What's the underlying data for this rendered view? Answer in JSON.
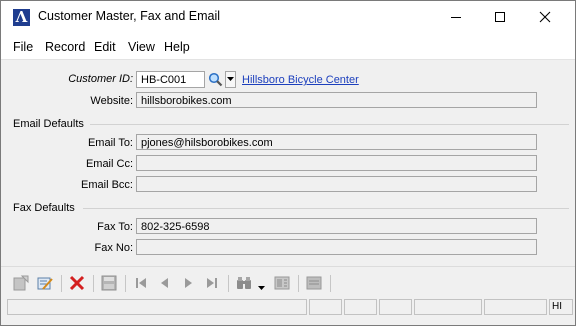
{
  "window": {
    "title": "Customer Master, Fax and Email"
  },
  "menu": [
    "File",
    "Record",
    "Edit",
    "View",
    "Help"
  ],
  "customer": {
    "id_label": "Customer ID:",
    "id_value": "HB-C001",
    "name_link": "Hillsboro Bicycle Center",
    "website_label": "Website:",
    "website_value": "hillsborobikes.com"
  },
  "email_defaults": {
    "section": "Email Defaults",
    "to_label": "Email To:",
    "to_value": "pjones@hilsborobikes.com",
    "cc_label": "Email Cc:",
    "cc_value": "",
    "bcc_label": "Email Bcc:",
    "bcc_value": ""
  },
  "fax_defaults": {
    "section": "Fax Defaults",
    "to_label": "Fax To:",
    "to_value": "802-325-6598",
    "no_label": "Fax No:",
    "no_value": ""
  },
  "toolbar_icons": [
    "new-record-icon",
    "edit-record-icon",
    "delete-icon",
    "save-icon",
    "first-record-icon",
    "previous-record-icon",
    "next-record-icon",
    "last-record-icon",
    "find-icon",
    "find-dropdown-icon",
    "memo-icon",
    "print-icon"
  ],
  "statusbar": {
    "last_panel": "HI"
  },
  "colors": {
    "accent": "#1f3d8f",
    "delete_red": "#d42020",
    "link": "#1c3fbd"
  }
}
